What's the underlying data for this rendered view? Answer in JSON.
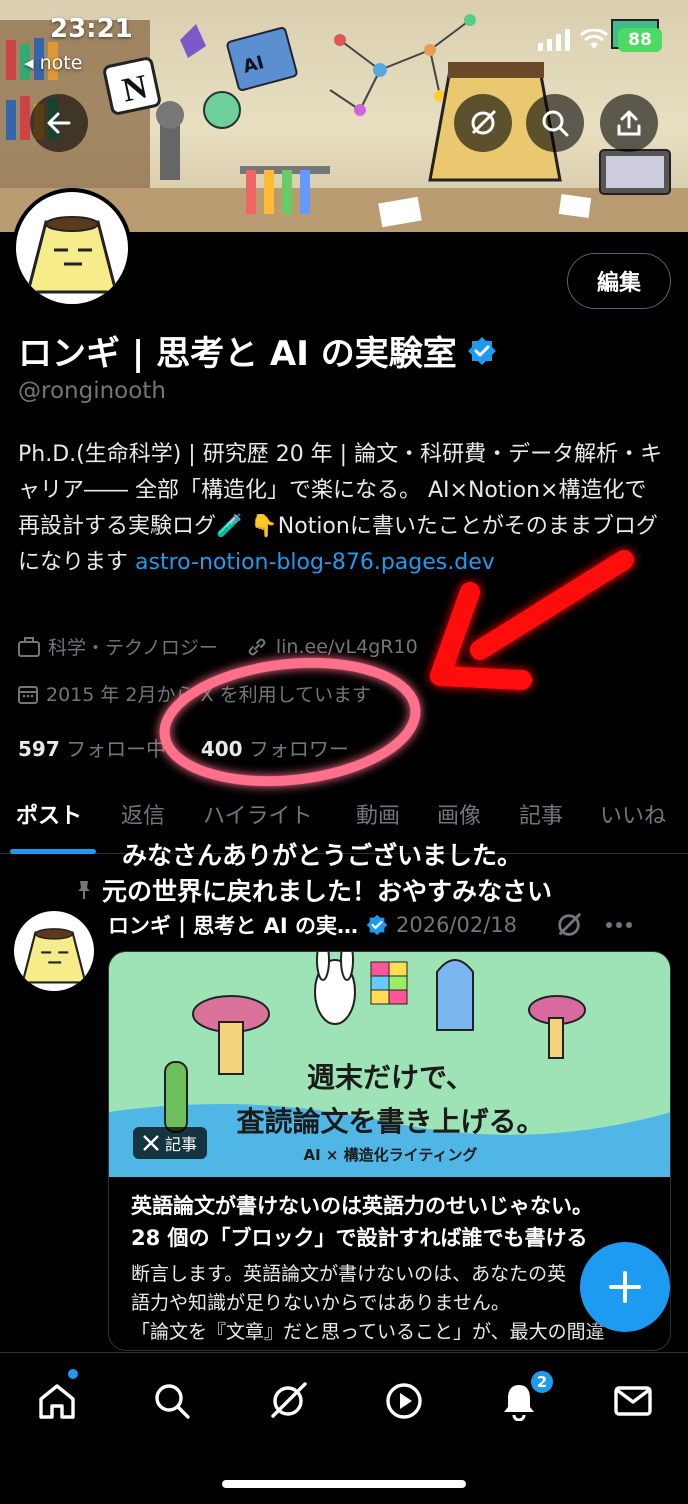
{
  "status_bar": {
    "time": "23:21",
    "back_app": "◂ note",
    "battery": "88"
  },
  "header_buttons": [
    "back-icon",
    "sync-icon",
    "search-icon",
    "share-icon"
  ],
  "profile": {
    "edit_label": "編集",
    "display_name": "ロンギ | 思考と AI の実験室",
    "handle": "@ronginooth",
    "bio_text": "Ph.D.(生命科学) | 研究歴 20 年 | 論文・科研費・データ解析・キャリア―― 全部「構造化」で楽になる。 AI×Notion×構造化で再設計する実験ログ🧪 👇Notionに書いたことがそのままブログになります ",
    "bio_link": "astro-notion-blog-876.pages.dev",
    "category": "科学・テクノロジー",
    "link": "lin.ee/vL4gR10",
    "joined": "2015 年 2月から X を利用しています",
    "following_count": "597",
    "following_label": " フォロー中",
    "followers_count": "400",
    "followers_label": " フォロワー"
  },
  "tabs": [
    "ポスト",
    "返信",
    "ハイライト",
    "動画",
    "画像",
    "記事",
    "いいね"
  ],
  "overlay": {
    "line1": "みなさんありがとうございました。",
    "line2": "元の世界に戻れました！おやすみなさい"
  },
  "post": {
    "author": "ロンギ | 思考と AI の実…",
    "date": "2026/02/18",
    "card_headline1": "週末だけで、",
    "card_headline2": "査読論文を書き上げる。",
    "card_sub": "AI × 構造化ライティング",
    "badge": "記事",
    "card_title_line1": "英語論文が書けないのは英語力のせいじゃない。",
    "card_title_line2": "28 個の「ブロック」で設計すれば誰でも書ける",
    "card_body_line1": "断言します。英語論文が書けないのは、あなたの英",
    "card_body_line2": "語力や知識が足りないからではありません。",
    "card_body_line3": "「論文を『文章』だと思っていること」が、最大の間違"
  },
  "bottom_nav": [
    "home-icon",
    "search-icon",
    "grok-icon",
    "video-icon",
    "notifications-icon",
    "messages-icon"
  ],
  "notification_count": "2",
  "colors": {
    "accent": "#1d9bf0",
    "annotation_red": "#ff2222"
  }
}
